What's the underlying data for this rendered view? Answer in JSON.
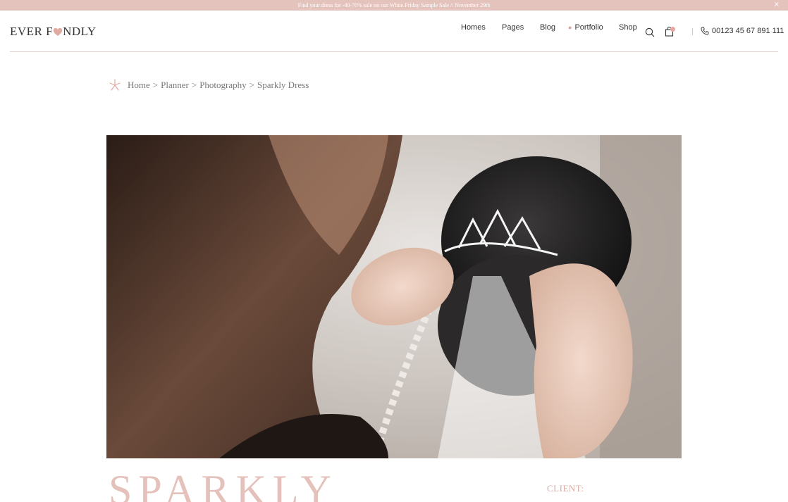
{
  "promo": {
    "text": "Find your dress for -40-70% sale on our White Friday Sample Sale // November 29th",
    "close": "×"
  },
  "header": {
    "logo_left": "EVER F",
    "logo_right": "NDLY",
    "nav": [
      {
        "label": "Homes"
      },
      {
        "label": "Pages"
      },
      {
        "label": "Blog"
      },
      {
        "label": "Portfolio"
      },
      {
        "label": "Shop"
      }
    ],
    "phone": "00123 45 67 891 111",
    "icons": [
      "search-icon",
      "cart-icon",
      "phone-icon"
    ],
    "accent_color": "#e5c3bd"
  },
  "breadcrumb": {
    "items": [
      "Home",
      "Planner",
      "Photography",
      "Sparkly Dress"
    ],
    "separator": ">"
  },
  "hero": {
    "image": "bride-veil-tiara-photo"
  },
  "project": {
    "title": "SPARKLY",
    "client_label": "CLIENT:"
  }
}
